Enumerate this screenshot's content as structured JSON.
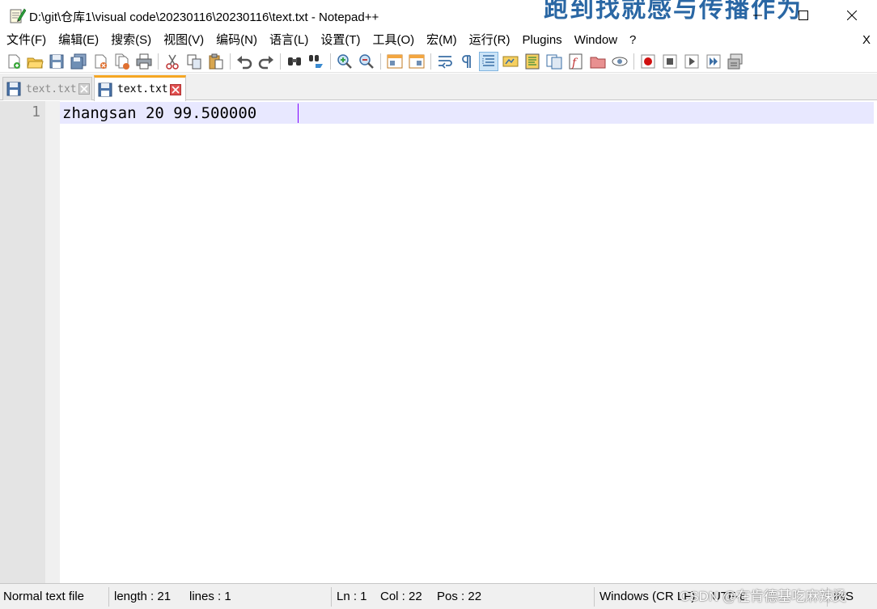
{
  "window": {
    "title": "D:\\git\\仓库1\\visual code\\20230116\\20230116\\text.txt - Notepad++",
    "overlay_text": "跑到找就感与传播作为"
  },
  "menu": {
    "items": [
      "文件(F)",
      "编辑(E)",
      "搜索(S)",
      "视图(V)",
      "编码(N)",
      "语言(L)",
      "设置(T)",
      "工具(O)",
      "宏(M)",
      "运行(R)",
      "Plugins",
      "Window",
      "?"
    ],
    "close_label": "X"
  },
  "toolbar": {
    "icons": [
      "new-file-icon",
      "open-file-icon",
      "save-icon",
      "save-all-icon",
      "close-icon",
      "close-all-icon",
      "print-icon",
      "cut-icon",
      "copy-icon",
      "paste-icon",
      "undo-icon",
      "redo-icon",
      "find-icon",
      "replace-icon",
      "zoom-in-icon",
      "zoom-out-icon",
      "sync-vertical-icon",
      "sync-horizontal-icon",
      "word-wrap-icon",
      "show-all-chars-icon",
      "indent-guide-icon",
      "udl-icon",
      "doc-map-icon",
      "doc-list-icon",
      "function-list-icon",
      "folder-workspace-icon",
      "monitoring-icon",
      "record-macro-icon",
      "stop-record-icon",
      "play-macro-icon",
      "run-macro-multiple-icon",
      "save-macro-icon"
    ]
  },
  "tabs": [
    {
      "label": "text.txt",
      "active": false
    },
    {
      "label": "text.txt",
      "active": true
    }
  ],
  "editor": {
    "line_number": "1",
    "line_content": "zhangsan 20 99.500000"
  },
  "statusbar": {
    "file_type": "Normal text file",
    "length": "length : 21",
    "lines": "lines : 1",
    "ln": "Ln : 1",
    "col": "Col : 22",
    "pos": "Pos : 22",
    "eol": "Windows (CR LF)",
    "encoding": "UTF-8",
    "mode": "INS",
    "watermark": "CSDN @在肯德基吃麻辣烫"
  },
  "colors": {
    "current_line": "#e8e8ff",
    "caret": "#8000ff",
    "active_tab_accent": "#f5a623",
    "gutter": "#e4e4e4"
  }
}
